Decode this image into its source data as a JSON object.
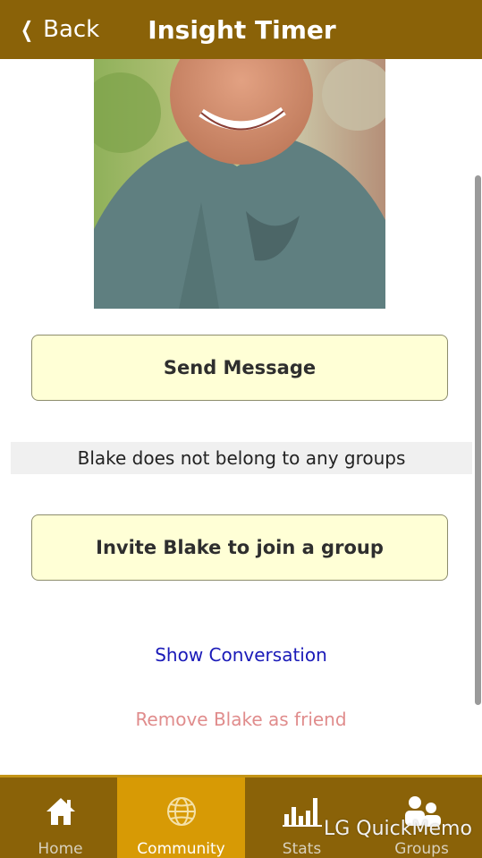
{
  "header": {
    "back_label": "Back",
    "title": "Insight Timer"
  },
  "profile": {
    "send_message_label": "Send Message",
    "groups_status": "Blake does not belong to any groups",
    "invite_label": "Invite Blake to join a group",
    "show_conversation_label": "Show Conversation",
    "remove_friend_label": "Remove Blake as friend"
  },
  "tabs": [
    {
      "label": "Home",
      "icon": "home-icon",
      "active": false
    },
    {
      "label": "Community",
      "icon": "globe-icon",
      "active": true
    },
    {
      "label": "Stats",
      "icon": "bar-chart-icon",
      "active": false
    },
    {
      "label": "Groups",
      "icon": "people-icon",
      "active": false
    }
  ],
  "overlay": {
    "watermark": "LG QuickMemo"
  },
  "colors": {
    "header_bg": "#8a6208",
    "active_tab_bg": "#d79a05",
    "button_bg": "#ffffd6",
    "link_blue": "#1a1ab8",
    "link_remove": "#e08c8c"
  }
}
